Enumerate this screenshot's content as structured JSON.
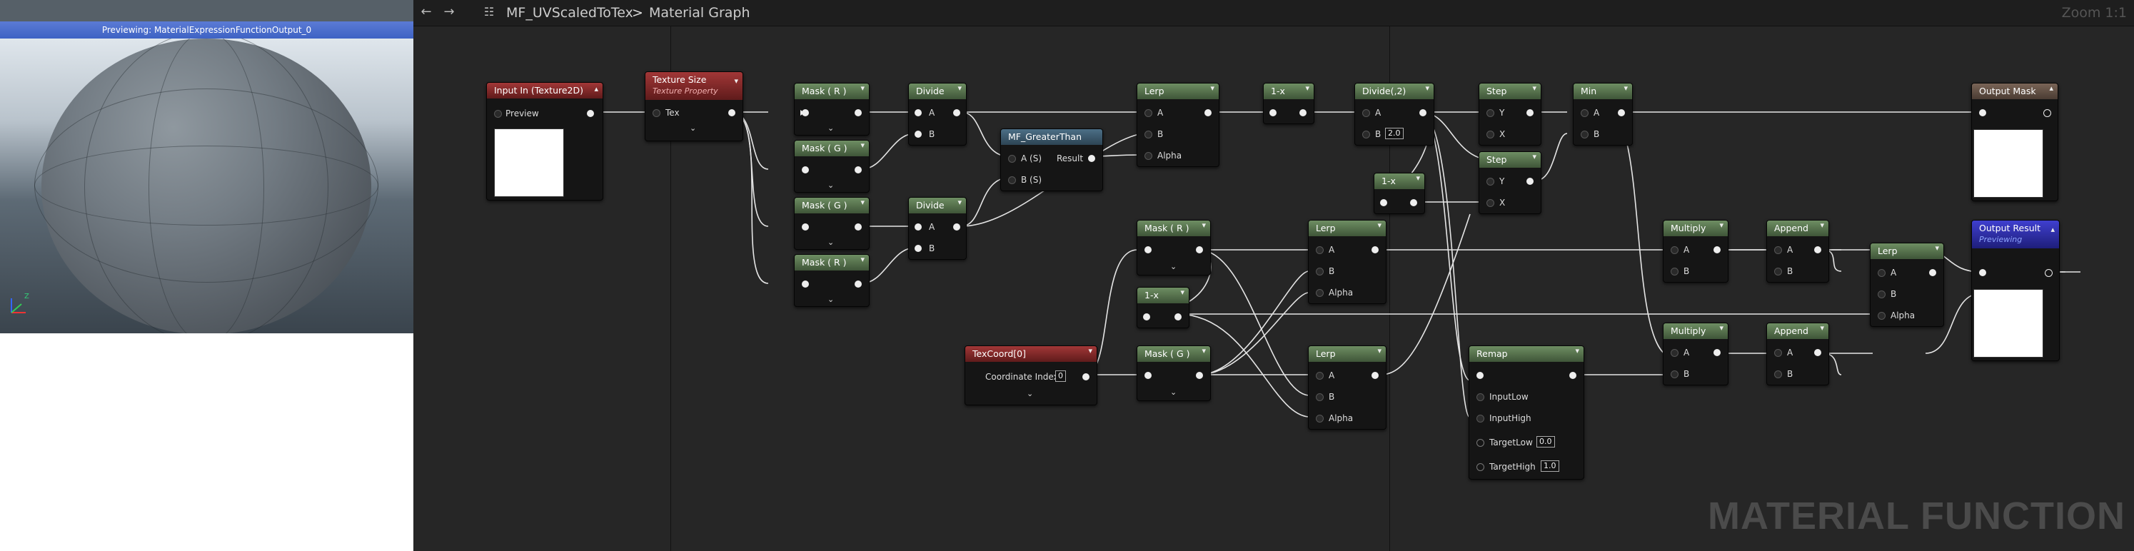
{
  "preview": {
    "title": "Previewing: MaterialExpressionFunctionOutput_0",
    "axis_label": "Z"
  },
  "toolbar": {
    "asset_name": "MF_UVScaledToTex",
    "separator": ">",
    "graph_name": "Material Graph",
    "zoom": "Zoom 1:1"
  },
  "watermark": "MATERIAL FUNCTION",
  "nodes": {
    "input_in": {
      "title": "Input In (Texture2D)",
      "pin_preview": "Preview"
    },
    "texture_size": {
      "title": "Texture Size",
      "subtitle": "Texture Property",
      "pin_tex": "Tex"
    },
    "mask_r1": {
      "title": "Mask ( R )"
    },
    "mask_g1": {
      "title": "Mask ( G )"
    },
    "mask_g2": {
      "title": "Mask ( G )"
    },
    "mask_r2": {
      "title": "Mask ( R )"
    },
    "divide1": {
      "title": "Divide",
      "a": "A",
      "b": "B"
    },
    "divide2": {
      "title": "Divide",
      "a": "A",
      "b": "B"
    },
    "greater_than": {
      "title": "MF_GreaterThan",
      "a": "A (S)",
      "b": "B (S)",
      "result": "Result"
    },
    "lerp1": {
      "title": "Lerp",
      "a": "A",
      "b": "B",
      "alpha": "Alpha"
    },
    "one_minus1": {
      "title": "1-x"
    },
    "divide3": {
      "title": "Divide(,2)",
      "a": "A",
      "b": "B",
      "b_value": "2.0"
    },
    "one_minus2": {
      "title": "1-x"
    },
    "step1": {
      "title": "Step",
      "y": "Y",
      "x": "X"
    },
    "step2": {
      "title": "Step",
      "y": "Y",
      "x": "X"
    },
    "min": {
      "title": "Min",
      "a": "A",
      "b": "B"
    },
    "output_mask": {
      "title": "Output Mask"
    },
    "mask_r3": {
      "title": "Mask ( R )"
    },
    "one_minus3": {
      "title": "1-x"
    },
    "mask_g3": {
      "title": "Mask ( G )"
    },
    "texcoord": {
      "title": "TexCoord[0]",
      "label": "Coordinate Index",
      "value": "0"
    },
    "lerp2": {
      "title": "Lerp",
      "a": "A",
      "b": "B",
      "alpha": "Alpha"
    },
    "lerp3": {
      "title": "Lerp",
      "a": "A",
      "b": "B",
      "alpha": "Alpha"
    },
    "remap": {
      "title": "Remap",
      "in_low": "InputLow",
      "in_high": "InputHigh",
      "t_low": "TargetLow",
      "t_low_value": "0.0",
      "t_high": "TargetHigh",
      "t_high_value": "1.0"
    },
    "multiply1": {
      "title": "Multiply",
      "a": "A",
      "b": "B"
    },
    "multiply2": {
      "title": "Multiply",
      "a": "A",
      "b": "B"
    },
    "append1": {
      "title": "Append",
      "a": "A",
      "b": "B"
    },
    "append2": {
      "title": "Append",
      "a": "A",
      "b": "B"
    },
    "lerp4": {
      "title": "Lerp",
      "a": "A",
      "b": "B",
      "alpha": "Alpha"
    },
    "output_result": {
      "title": "Output Result",
      "subtitle": "Previewing"
    }
  }
}
